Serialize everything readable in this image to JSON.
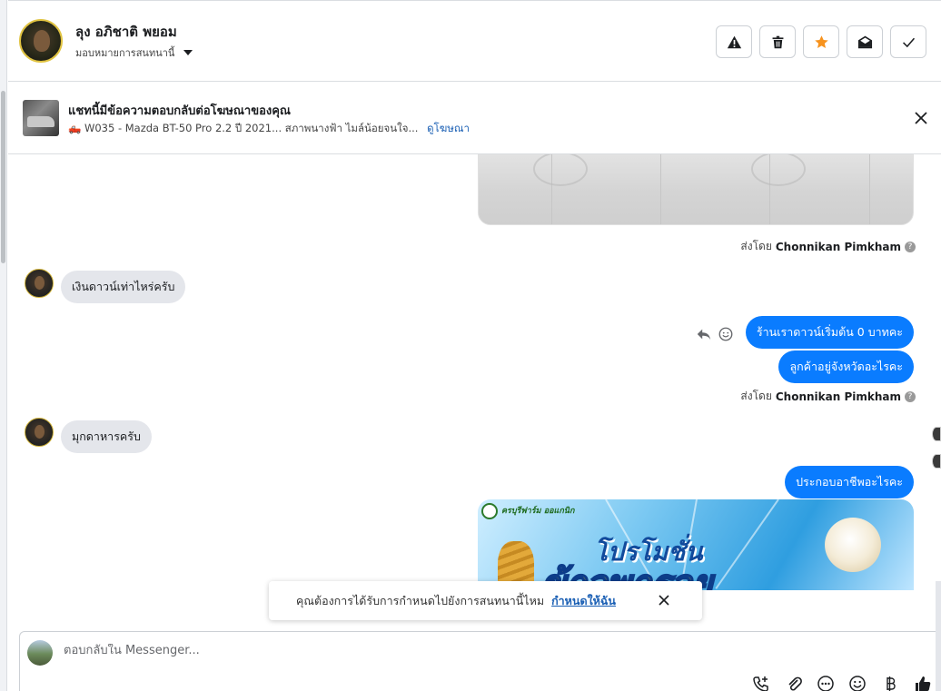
{
  "header": {
    "contact_name": "ลุง อภิชาติ พยอม",
    "assign_label": "มอบหมายการสนทนานี้",
    "actions": [
      "report-icon",
      "trash-icon",
      "star-icon",
      "mark-unread-icon",
      "done-check-icon"
    ],
    "star_color": "#f7931e"
  },
  "ad_banner": {
    "title": "แชทนี้มีข้อความตอบกลับต่อโฆษณาของคุณ",
    "subtitle": "🛻 W035 - Mazda BT-50 Pro 2.2 ปี 2021... สภาพนางฟ้า ไมล์น้อยจนใจ...",
    "link": "ดูโฆษณา"
  },
  "messages": {
    "sent_by_prefix": "ส่งโดย",
    "agent_name": "Chonnikan Pimkham",
    "incoming_1": "เงินดาวน์เท่าไหร่ครับ",
    "outgoing_1": "ร้านเราดาวน์เริ่มต้น 0 บาทคะ",
    "outgoing_2": "ลูกค้าอยู่จังหวัดอะไรคะ",
    "incoming_2": "มุกดาหารครับ",
    "outgoing_3": "ประกอบอาชีพอะไรคะ",
    "promo": {
      "brand": "ครบุรีฟาร์ม ออแกนิก",
      "line1": "โปรโมชั่น",
      "line2": "ข้าวพารวย"
    }
  },
  "toast": {
    "text": "คุณต้องการได้รับการกำหนดไปยังการสนทนานี้ไหม",
    "link": "กำหนดให้ฉัน"
  },
  "composer": {
    "placeholder": "ตอบกลับใน Messenger...",
    "tools": [
      "call-add-icon",
      "attach-icon",
      "more-dots-icon",
      "emoji-icon",
      "baht-icon",
      "thumbs-up-icon"
    ]
  },
  "colors": {
    "outgoing_bubble": "#0a7cff",
    "incoming_bubble": "#e4e6eb",
    "link": "#1a5fb4"
  }
}
